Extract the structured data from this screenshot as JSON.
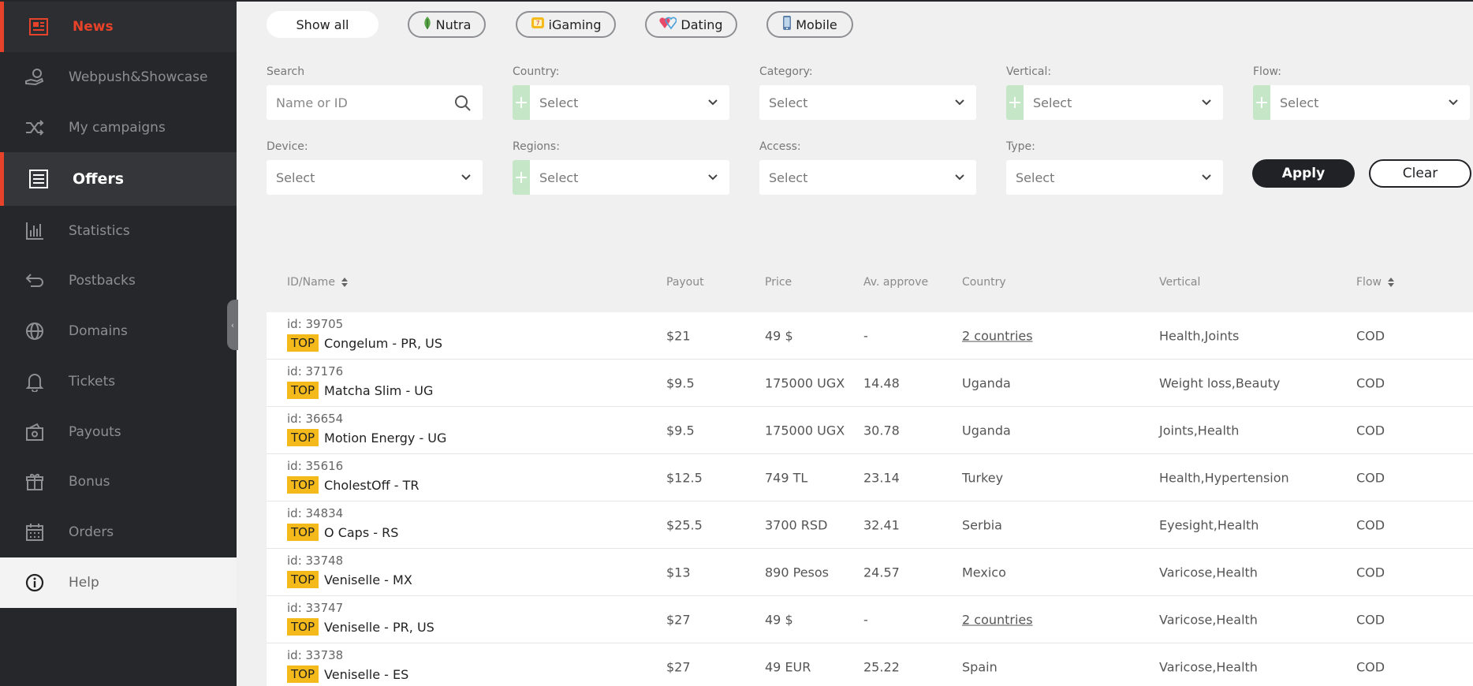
{
  "sidebar": {
    "items": [
      {
        "label": "News",
        "icon": "newspaper-icon"
      },
      {
        "label": "Webpush&Showcase",
        "icon": "hand-coin-icon"
      },
      {
        "label": "My campaigns",
        "icon": "shuffle-icon"
      },
      {
        "label": "Offers",
        "icon": "list-icon"
      },
      {
        "label": "Statistics",
        "icon": "bar-chart-icon"
      },
      {
        "label": "Postbacks",
        "icon": "return-arrow-icon"
      },
      {
        "label": "Domains",
        "icon": "globe-icon"
      },
      {
        "label": "Tickets",
        "icon": "bell-icon"
      },
      {
        "label": "Payouts",
        "icon": "wallet-icon"
      },
      {
        "label": "Bonus",
        "icon": "gift-icon"
      },
      {
        "label": "Orders",
        "icon": "calendar-icon"
      },
      {
        "label": "Help",
        "icon": "info-icon"
      }
    ],
    "collapse_glyph": "‹"
  },
  "chips": [
    {
      "label": "Show all"
    },
    {
      "label": "Nutra",
      "icon": "leaf-icon"
    },
    {
      "label": "iGaming",
      "icon": "slot-icon"
    },
    {
      "label": "Dating",
      "icon": "hearts-icon"
    },
    {
      "label": "Mobile",
      "icon": "phone-icon"
    }
  ],
  "filters": {
    "search": {
      "label": "Search",
      "placeholder": "Name or ID"
    },
    "country": {
      "label": "Country:",
      "value": "Select"
    },
    "category": {
      "label": "Category:",
      "value": "Select"
    },
    "vertical": {
      "label": "Vertical:",
      "value": "Select"
    },
    "flow": {
      "label": "Flow:",
      "value": "Select"
    },
    "device": {
      "label": "Device:",
      "value": "Select"
    },
    "regions": {
      "label": "Regions:",
      "value": "Select"
    },
    "access": {
      "label": "Access:",
      "value": "Select"
    },
    "type": {
      "label": "Type:",
      "value": "Select"
    },
    "plus_glyph": "+",
    "apply_label": "Apply",
    "clear_label": "Clear"
  },
  "table": {
    "headers": {
      "id_name": "ID/Name",
      "payout": "Payout",
      "price": "Price",
      "approve": "Av. approve",
      "country": "Country",
      "vertical": "Vertical",
      "flow": "Flow"
    },
    "rows": [
      {
        "id": "id: 39705",
        "badge": "TOP",
        "name": "Congelum - PR, US",
        "payout": "$21",
        "price": "49 $",
        "approve": "-",
        "country": "2 countries",
        "country_link": true,
        "vertical": "Health,Joints",
        "flow": "COD"
      },
      {
        "id": "id: 37176",
        "badge": "TOP",
        "name": "Matcha Slim - UG",
        "payout": "$9.5",
        "price": "175000 UGX",
        "approve": "14.48",
        "country": "Uganda",
        "country_link": false,
        "vertical": "Weight loss,Beauty",
        "flow": "COD"
      },
      {
        "id": "id: 36654",
        "badge": "TOP",
        "name": "Motion Energy - UG",
        "payout": "$9.5",
        "price": "175000 UGX",
        "approve": "30.78",
        "country": "Uganda",
        "country_link": false,
        "vertical": "Joints,Health",
        "flow": "COD"
      },
      {
        "id": "id: 35616",
        "badge": "TOP",
        "name": "CholestOff - TR",
        "payout": "$12.5",
        "price": "749 TL",
        "approve": "23.14",
        "country": "Turkey",
        "country_link": false,
        "vertical": "Health,Hypertension",
        "flow": "COD"
      },
      {
        "id": "id: 34834",
        "badge": "TOP",
        "name": "O Caps - RS",
        "payout": "$25.5",
        "price": "3700 RSD",
        "approve": "32.41",
        "country": "Serbia",
        "country_link": false,
        "vertical": "Eyesight,Health",
        "flow": "COD"
      },
      {
        "id": "id: 33748",
        "badge": "TOP",
        "name": "Veniselle - MX",
        "payout": "$13",
        "price": "890 Pesos",
        "approve": "24.57",
        "country": "Mexico",
        "country_link": false,
        "vertical": "Varicose,Health",
        "flow": "COD"
      },
      {
        "id": "id: 33747",
        "badge": "TOP",
        "name": "Veniselle - PR, US",
        "payout": "$27",
        "price": "49 $",
        "approve": "-",
        "country": "2 countries",
        "country_link": true,
        "vertical": "Varicose,Health",
        "flow": "COD"
      },
      {
        "id": "id: 33738",
        "badge": "TOP",
        "name": "Veniselle - ES",
        "payout": "$27",
        "price": "49 EUR",
        "approve": "25.22",
        "country": "Spain",
        "country_link": false,
        "vertical": "Varicose,Health",
        "flow": "COD"
      }
    ]
  },
  "colors": {
    "accent": "#e8432a",
    "sidebar_bg": "#25272a",
    "badge": "#f4b91a",
    "plus_bg": "#c6e6c8"
  }
}
